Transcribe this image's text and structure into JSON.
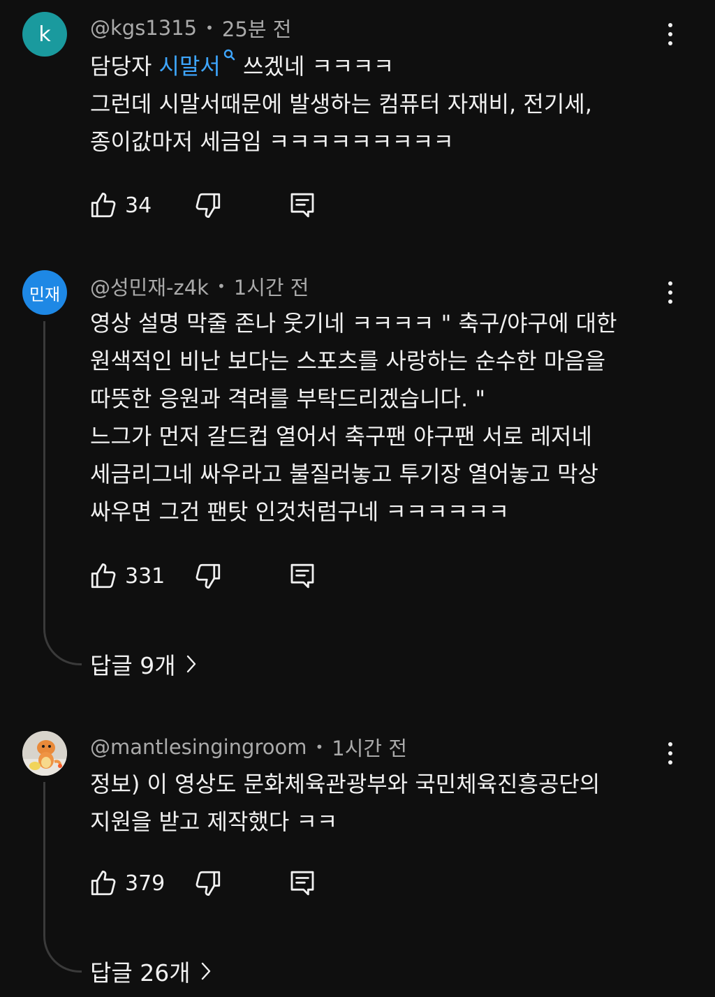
{
  "comments": [
    {
      "avatar_text": "k",
      "author": "@kgs1315",
      "time": "25분 전",
      "text_prefix": "담당자 ",
      "text_link": "시말서",
      "text_suffix": " 쓰겠네 ㅋㅋㅋㅋ",
      "lines": [
        "그런데 시말서때문에 발생하는 컴퓨터 자재비, 전기세,",
        "종이값마저 세금임 ㅋㅋㅋㅋㅋㅋㅋㅋㅋ"
      ],
      "likes": "34"
    },
    {
      "avatar_text": "민재",
      "author": "@성민재-z4k",
      "time": "1시간 전",
      "lines": [
        "영상 설명 막줄 존나 웃기네 ㅋㅋㅋㅋ \"  축구/야구에 대한",
        "원색적인 비난 보다는 스포츠를 사랑하는 순수한 마음을",
        "따뜻한 응원과 격려를 부탁드리겠습니다. \"",
        "느그가 먼저 갈드컵 열어서 축구팬 야구팬 서로 레저네",
        "세금리그네 싸우라고 불질러놓고 투기장 열어놓고 막상",
        "싸우면 그건 팬탓 인것처럼구네 ㅋㅋㅋㅋㅋㅋ"
      ],
      "likes": "331",
      "replies": "답글 9개"
    },
    {
      "avatar_icon": "charmander-avatar",
      "author": "@mantlesingingroom",
      "time": "1시간 전",
      "lines": [
        "정보) 이 영상도 문화체육관광부와 국민체육진흥공단의",
        "지원을 받고 제작했다 ㅋㅋ"
      ],
      "likes": "379",
      "replies": "답글 26개"
    }
  ],
  "separator": "•",
  "colors": {
    "background": "#0f0f0f",
    "text": "#f1f1f1",
    "meta": "#aaaaaa",
    "link": "#3ea6ff",
    "avatar_k": "#1a9a9e",
    "avatar_minjae": "#1e88e5"
  },
  "icons": [
    "thumbs-up-icon",
    "thumbs-down-icon",
    "reply-icon",
    "more-vert-icon",
    "search-icon",
    "chevron-right-icon"
  ]
}
